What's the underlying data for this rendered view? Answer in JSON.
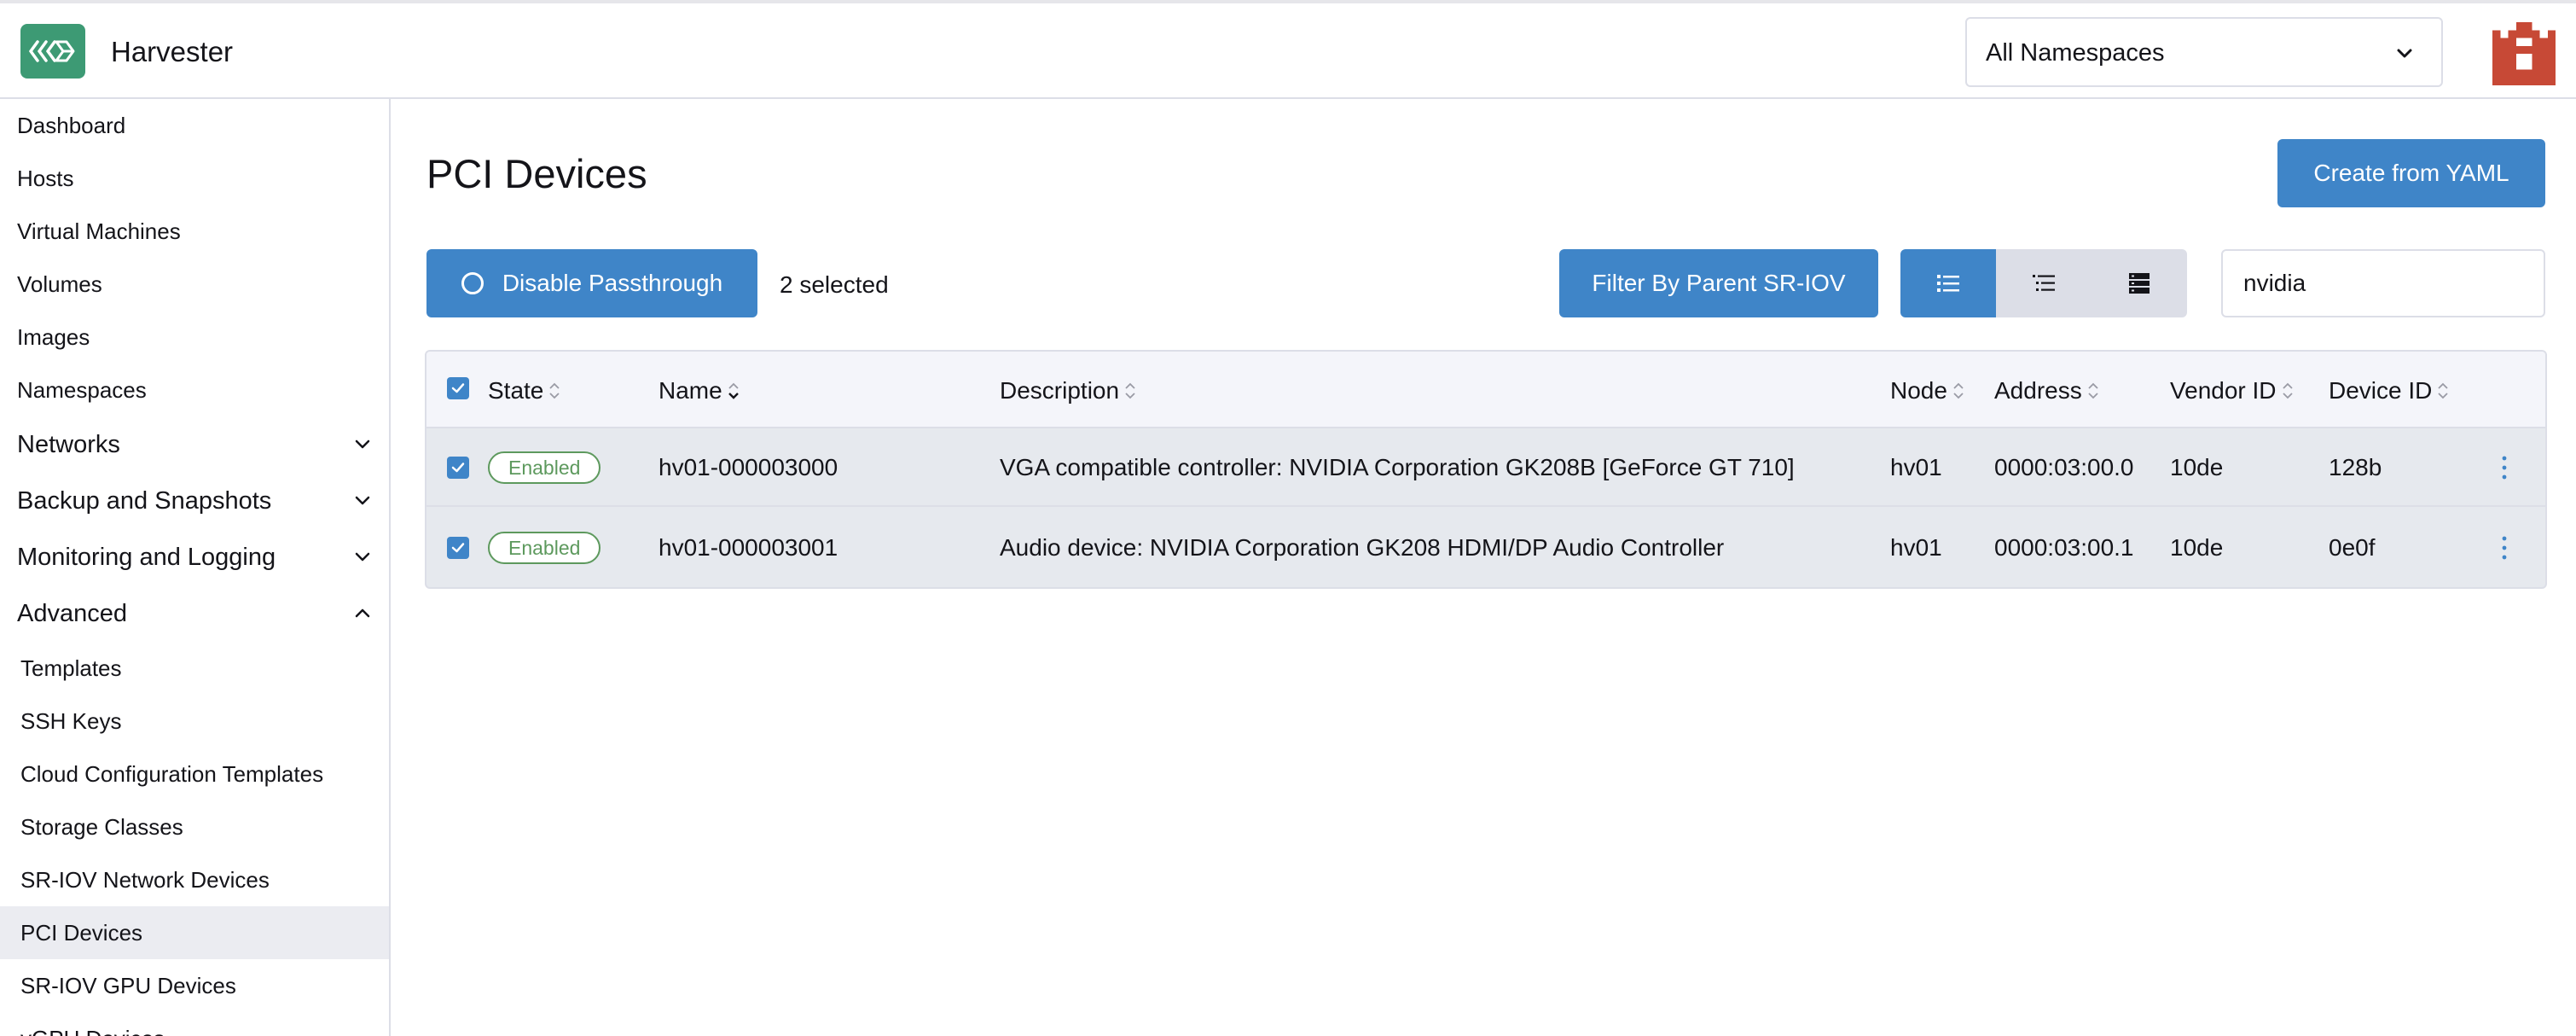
{
  "header": {
    "app_name": "Harvester",
    "namespace_select": "All Namespaces",
    "brand_color": "#3d9a74",
    "avatar_color": "#c74936"
  },
  "sidebar": {
    "top_items": [
      "Dashboard",
      "Hosts",
      "Virtual Machines",
      "Volumes",
      "Images",
      "Namespaces"
    ],
    "groups": [
      {
        "label": "Networks",
        "expanded": false
      },
      {
        "label": "Backup and Snapshots",
        "expanded": false
      },
      {
        "label": "Monitoring and Logging",
        "expanded": false
      },
      {
        "label": "Advanced",
        "expanded": true
      }
    ],
    "advanced_items": [
      "Templates",
      "SSH Keys",
      "Cloud Configuration Templates",
      "Storage Classes",
      "SR-IOV Network Devices",
      "PCI Devices",
      "SR-IOV GPU Devices",
      "vGPU Devices"
    ],
    "active_item": "PCI Devices"
  },
  "main": {
    "title": "PCI Devices",
    "create_button": "Create from YAML",
    "disable_button": "Disable Passthrough",
    "selected_count": "2 selected",
    "filter_button": "Filter By Parent SR-IOV",
    "search_value": "nvidia",
    "view_mode": "flat-list"
  },
  "table": {
    "columns": [
      "State",
      "Name",
      "Description",
      "Node",
      "Address",
      "Vendor ID",
      "Device ID"
    ],
    "sorted_by": "Name",
    "rows": [
      {
        "checked": true,
        "state": "Enabled",
        "name": "hv01-000003000",
        "description": "VGA compatible controller: NVIDIA Corporation GK208B [GeForce GT 710]",
        "node": "hv01",
        "address": "0000:03:00.0",
        "vendor_id": "10de",
        "device_id": "128b"
      },
      {
        "checked": true,
        "state": "Enabled",
        "name": "hv01-000003001",
        "description": "Audio device: NVIDIA Corporation GK208 HDMI/DP Audio Controller",
        "node": "hv01",
        "address": "0000:03:00.1",
        "vendor_id": "10de",
        "device_id": "0e0f"
      }
    ]
  },
  "colors": {
    "primary": "#3f85c8",
    "enabled_badge": "#5d995d"
  }
}
